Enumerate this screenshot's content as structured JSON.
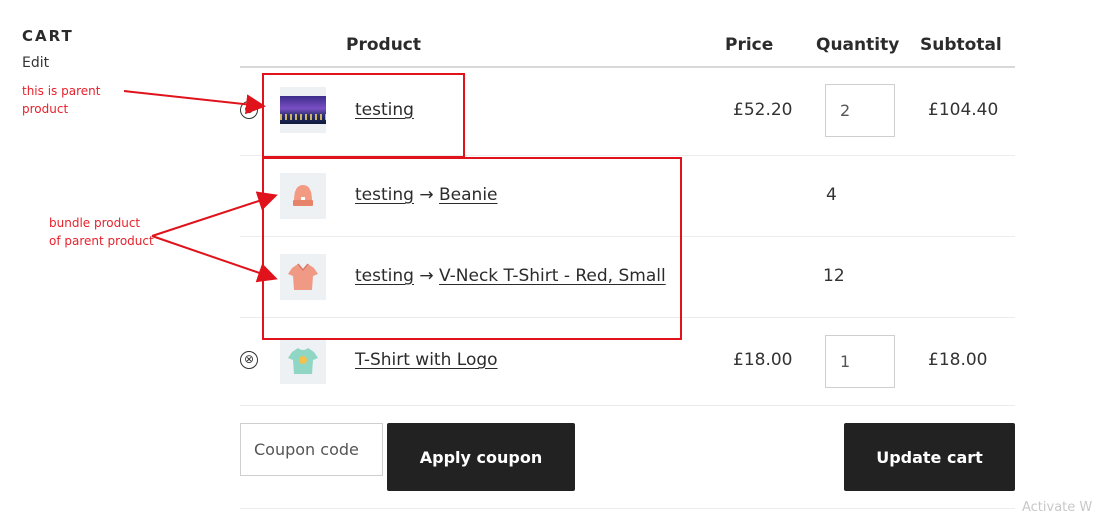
{
  "sidebar": {
    "title": "CART",
    "edit_label": "Edit"
  },
  "table": {
    "headers": {
      "product": "Product",
      "price": "Price",
      "quantity": "Quantity",
      "subtotal": "Subtotal"
    },
    "rows": [
      {
        "name": "testing",
        "price": "£52.20",
        "quantity": "2",
        "subtotal": "£104.40",
        "image": "city-night"
      },
      {
        "parent": "testing",
        "arrow": "→",
        "name": "Beanie",
        "quantity": "4",
        "image": "beanie"
      },
      {
        "parent": "testing",
        "arrow": "→",
        "name": "V-Neck T-Shirt - Red, Small",
        "quantity": "12",
        "image": "vneck-tshirt"
      },
      {
        "name": "T-Shirt with Logo",
        "price": "£18.00",
        "quantity": "1",
        "subtotal": "£18.00",
        "image": "tshirt-logo"
      }
    ],
    "remove_symbol": "⊗"
  },
  "actions": {
    "coupon_placeholder": "Coupon code",
    "apply_coupon": "Apply coupon",
    "update_cart": "Update cart"
  },
  "annotations": {
    "parent_note_line1": "this is parent",
    "parent_note_line2": "product",
    "bundle_note_line1": "bundle product",
    "bundle_note_line2": "of parent product"
  },
  "watermark": "Activate W",
  "colors": {
    "button_bg": "#222222",
    "annotation_red": "#e0121b",
    "text": "#333333"
  }
}
